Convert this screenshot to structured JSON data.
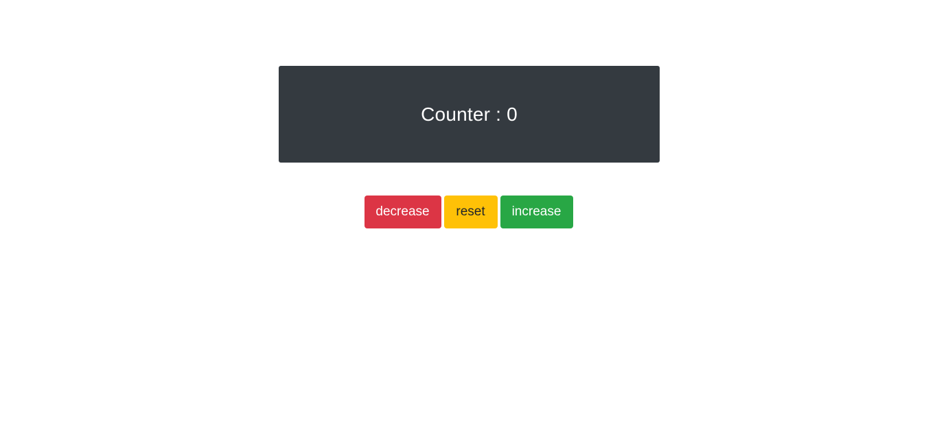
{
  "counter": {
    "label": "Counter",
    "separator": " : ",
    "value": "0"
  },
  "buttons": {
    "decrease": "decrease",
    "reset": "reset",
    "increase": "increase"
  },
  "colors": {
    "panel_bg": "#343a40",
    "decrease_bg": "#dc3545",
    "reset_bg": "#ffc107",
    "increase_bg": "#28a745"
  }
}
